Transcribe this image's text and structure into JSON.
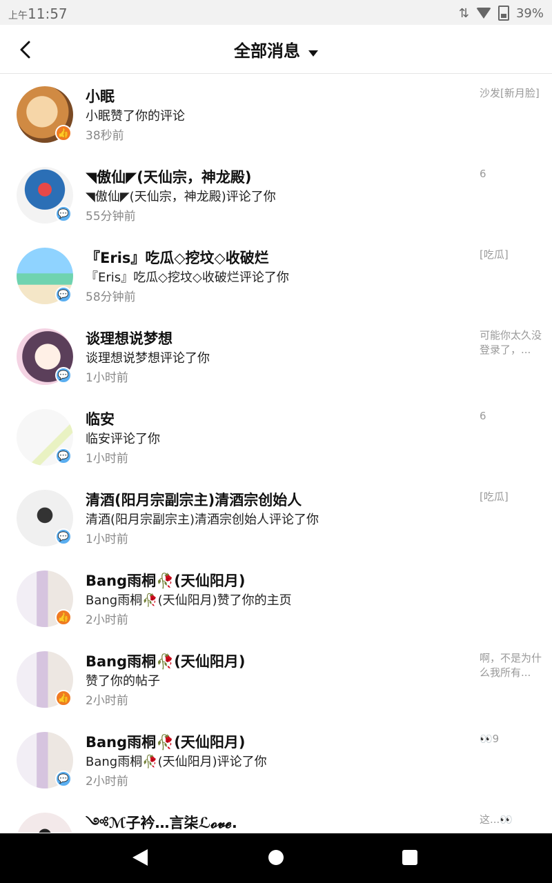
{
  "status": {
    "ampm": "上午",
    "time": "11:57",
    "battery": "39%"
  },
  "header": {
    "title": "全部消息"
  },
  "items": [
    {
      "name": "小眠",
      "action": "小眠赞了你的评论",
      "time": "38秒前",
      "snippet": "沙发[新月脸]",
      "type": "like"
    },
    {
      "name": "◥傲仙◤(天仙宗，神龙殿)",
      "action": "◥傲仙◤(天仙宗，神龙殿)评论了你",
      "time": "55分钟前",
      "snippet": "6",
      "type": "comment"
    },
    {
      "name": "『Eris』吃瓜◇挖坟◇收破烂",
      "action": "『Eris』吃瓜◇挖坟◇收破烂评论了你",
      "time": "58分钟前",
      "snippet": "[吃瓜]",
      "type": "comment"
    },
    {
      "name": "谈理想说梦想",
      "action": "谈理想说梦想评论了你",
      "time": "1小时前",
      "snippet": "可能你太久没登录了，...",
      "type": "comment"
    },
    {
      "name": "临安",
      "action": "临安评论了你",
      "time": "1小时前",
      "snippet": "6",
      "type": "comment"
    },
    {
      "name": "清酒(阳月宗副宗主)清酒宗创始人",
      "action": "清酒(阳月宗副宗主)清酒宗创始人评论了你",
      "time": "1小时前",
      "snippet": "[吃瓜]",
      "type": "comment"
    },
    {
      "name": "Bang雨桐🥀(天仙阳月)",
      "action": "Bang雨桐🥀(天仙阳月)赞了你的主页",
      "time": "2小时前",
      "snippet": "",
      "type": "like"
    },
    {
      "name": "Bang雨桐🥀(天仙阳月)",
      "action": "赞了你的帖子",
      "time": "2小时前",
      "snippet": "啊，不是为什么我所有...",
      "type": "like"
    },
    {
      "name": "Bang雨桐🥀(天仙阳月)",
      "action": "Bang雨桐🥀(天仙阳月)评论了你",
      "time": "2小时前",
      "snippet": "👀9",
      "type": "comment"
    },
    {
      "name": "༺ℳ子衿…言柒ℒ𝓸𝓿𝓮.",
      "action": "",
      "time": "",
      "snippet": "这...👀",
      "type": "comment"
    }
  ],
  "icons": {
    "back": "chevron-left-icon",
    "like": "thumbs-up-icon",
    "comment": "comment-bubble-icon"
  },
  "colors": {
    "like_badge": "#f07a22",
    "comment_badge": "#5aaef0"
  }
}
